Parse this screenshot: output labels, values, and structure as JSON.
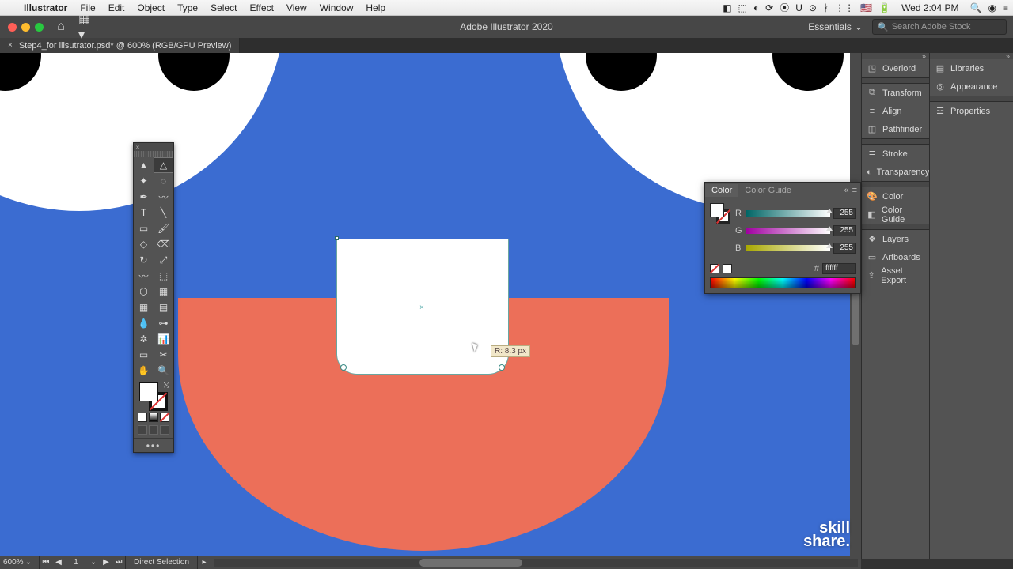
{
  "os": {
    "app_name": "Illustrator",
    "menus": [
      "File",
      "Edit",
      "Object",
      "Type",
      "Select",
      "Effect",
      "View",
      "Window",
      "Help"
    ],
    "clock": "Wed 2:04 PM"
  },
  "app": {
    "title": "Adobe Illustrator 2020",
    "workspace": "Essentials",
    "search_placeholder": "Search Adobe Stock"
  },
  "doc": {
    "tab_title": "Step4_for illsutrator.psd* @ 600% (RGB/GPU Preview)"
  },
  "panels_a": {
    "group1": [
      {
        "icon": "overlord-icon",
        "label": "Overlord"
      }
    ],
    "group2": [
      {
        "icon": "transform-icon",
        "label": "Transform"
      },
      {
        "icon": "align-icon",
        "label": "Align"
      },
      {
        "icon": "pathfinder-icon",
        "label": "Pathfinder"
      }
    ],
    "group3": [
      {
        "icon": "stroke-icon",
        "label": "Stroke"
      },
      {
        "icon": "transparency-icon",
        "label": "Transparency"
      }
    ],
    "group4": [
      {
        "icon": "color-icon",
        "label": "Color"
      },
      {
        "icon": "color-guide-icon",
        "label": "Color Guide"
      }
    ],
    "group5": [
      {
        "icon": "layers-icon",
        "label": "Layers"
      },
      {
        "icon": "artboards-icon",
        "label": "Artboards"
      },
      {
        "icon": "asset-export-icon",
        "label": "Asset Export"
      }
    ]
  },
  "panels_b": {
    "group1": [
      {
        "icon": "libraries-icon",
        "label": "Libraries"
      },
      {
        "icon": "appearance-icon",
        "label": "Appearance"
      }
    ],
    "group2": [
      {
        "icon": "properties-icon",
        "label": "Properties"
      }
    ]
  },
  "color_panel": {
    "tab_color": "Color",
    "tab_guide": "Color Guide",
    "r_label": "R",
    "r_value": "255",
    "g_label": "G",
    "g_value": "255",
    "b_label": "B",
    "b_value": "255",
    "hash": "#",
    "hex_value": "ffffff"
  },
  "tooltip": {
    "radius": "R: 8.3 px"
  },
  "status": {
    "zoom": "600%",
    "artboard_num": "1",
    "tool": "Direct Selection"
  },
  "brand": {
    "line1": "skill",
    "line2": "share"
  },
  "tools": {
    "row_labels": [
      "selection-tool",
      "direct-selection-tool",
      "magic-wand-tool",
      "lasso-tool",
      "pen-tool",
      "curvature-tool",
      "type-tool",
      "line-segment-tool",
      "rectangle-tool",
      "paintbrush-tool",
      "shaper-tool",
      "eraser-tool",
      "rotate-tool",
      "scale-tool",
      "width-tool",
      "free-transform-tool",
      "shape-builder-tool",
      "perspective-grid-tool",
      "mesh-tool",
      "gradient-tool",
      "eyedropper-tool",
      "blend-tool",
      "symbol-sprayer-tool",
      "column-graph-tool",
      "artboard-tool",
      "slice-tool",
      "hand-tool",
      "zoom-tool"
    ],
    "selected_index": 1
  },
  "colors": {
    "canvas_blue": "#3b6cd1",
    "mouth_coral": "#ec6f59"
  }
}
